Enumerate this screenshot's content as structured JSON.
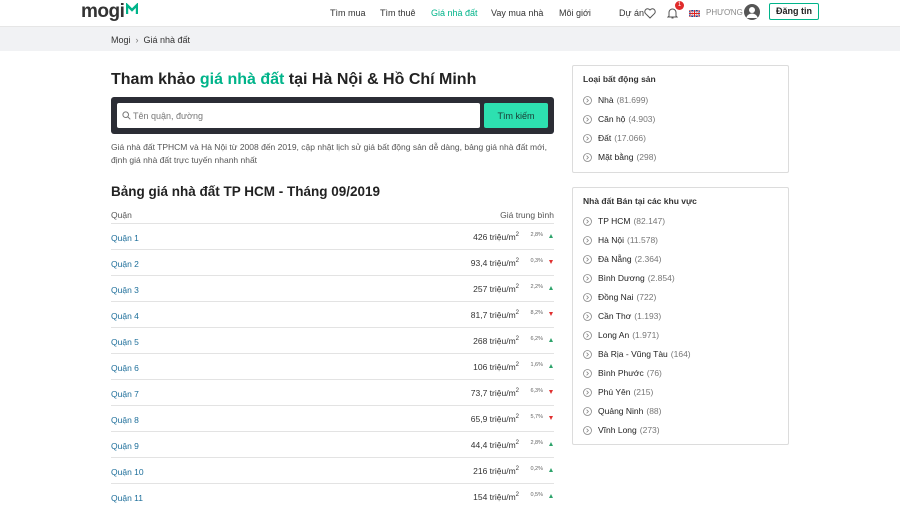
{
  "header": {
    "logo": "mogi",
    "nav": [
      {
        "label": "Tìm mua",
        "active": false
      },
      {
        "label": "Tìm thuê",
        "active": false
      },
      {
        "label": "Giá nhà đất",
        "active": true
      },
      {
        "label": "Vay mua nhà",
        "active": false
      },
      {
        "label": "Môi giới",
        "active": false
      },
      {
        "label": "Dự án",
        "active": false
      }
    ],
    "notification_count": "1",
    "username": "PHƯƠNG",
    "register_label": "Đăng tin",
    "accent": "#00b48a"
  },
  "breadcrumb": {
    "home": "Mogi",
    "current": "Giá nhà đất"
  },
  "main": {
    "title_prefix": "Tham khảo ",
    "title_highlight": "giá nhà đất",
    "title_suffix": " tại Hà Nội & Hồ Chí Minh",
    "search": {
      "placeholder": "Tên quận, đường",
      "value": "",
      "button_label": "Tìm kiếm"
    },
    "description": "Giá nhà đất TPHCM và Hà Nội từ 2008 đến 2019, cập nhật lịch sử giá bất động sản dễ dàng, bảng giá nhà đất mới, định giá nhà đất trực tuyến nhanh nhất",
    "table": {
      "title": "Bảng giá nhà đất TP HCM - Tháng 09/2019",
      "col_district": "Quận",
      "col_price": "Giá trung bình",
      "unit": "triệu/m",
      "rows": [
        {
          "name": "Quận 1",
          "price": "426",
          "change": "2,8%",
          "dir": "up"
        },
        {
          "name": "Quận 2",
          "price": "93,4",
          "change": "0,3%",
          "dir": "down"
        },
        {
          "name": "Quận 3",
          "price": "257",
          "change": "2,2%",
          "dir": "up"
        },
        {
          "name": "Quận 4",
          "price": "81,7",
          "change": "8,2%",
          "dir": "down"
        },
        {
          "name": "Quận 5",
          "price": "268",
          "change": "6,2%",
          "dir": "up"
        },
        {
          "name": "Quận 6",
          "price": "106",
          "change": "1,6%",
          "dir": "up"
        },
        {
          "name": "Quận 7",
          "price": "73,7",
          "change": "6,3%",
          "dir": "down"
        },
        {
          "name": "Quận 8",
          "price": "65,9",
          "change": "5,7%",
          "dir": "down"
        },
        {
          "name": "Quận 9",
          "price": "44,4",
          "change": "2,8%",
          "dir": "up"
        },
        {
          "name": "Quận 10",
          "price": "216",
          "change": "0,2%",
          "dir": "up"
        },
        {
          "name": "Quận 11",
          "price": "154",
          "change": "0,5%",
          "dir": "up"
        }
      ]
    }
  },
  "sidebar": {
    "property_types": {
      "title": "Loại bất động sản",
      "items": [
        {
          "label": "Nhà",
          "count": "(81.699)"
        },
        {
          "label": "Căn hộ",
          "count": "(4.903)"
        },
        {
          "label": "Đất",
          "count": "(17.066)"
        },
        {
          "label": "Mặt bằng",
          "count": "(298)"
        }
      ]
    },
    "regions": {
      "title": "Nhà đất Bán tại các khu vực",
      "items": [
        {
          "label": "TP HCM",
          "count": "(82.147)"
        },
        {
          "label": "Hà Nội",
          "count": "(11.578)"
        },
        {
          "label": "Đà Nẵng",
          "count": "(2.364)"
        },
        {
          "label": "Bình Dương",
          "count": "(2.854)"
        },
        {
          "label": "Đồng Nai",
          "count": "(722)"
        },
        {
          "label": "Cần Thơ",
          "count": "(1.193)"
        },
        {
          "label": "Long An",
          "count": "(1.971)"
        },
        {
          "label": "Bà Rịa - Vũng Tàu",
          "count": "(164)"
        },
        {
          "label": "Bình Phước",
          "count": "(76)"
        },
        {
          "label": "Phú Yên",
          "count": "(215)"
        },
        {
          "label": "Quảng Ninh",
          "count": "(88)"
        },
        {
          "label": "Vĩnh Long",
          "count": "(273)"
        }
      ]
    }
  },
  "icons": {
    "favorite": "heart-icon",
    "notification": "bell-icon",
    "language": "uk-flag-icon",
    "user": "user-avatar-icon",
    "search": "search-icon",
    "list_bullet": "chevron-right-circle-icon"
  }
}
